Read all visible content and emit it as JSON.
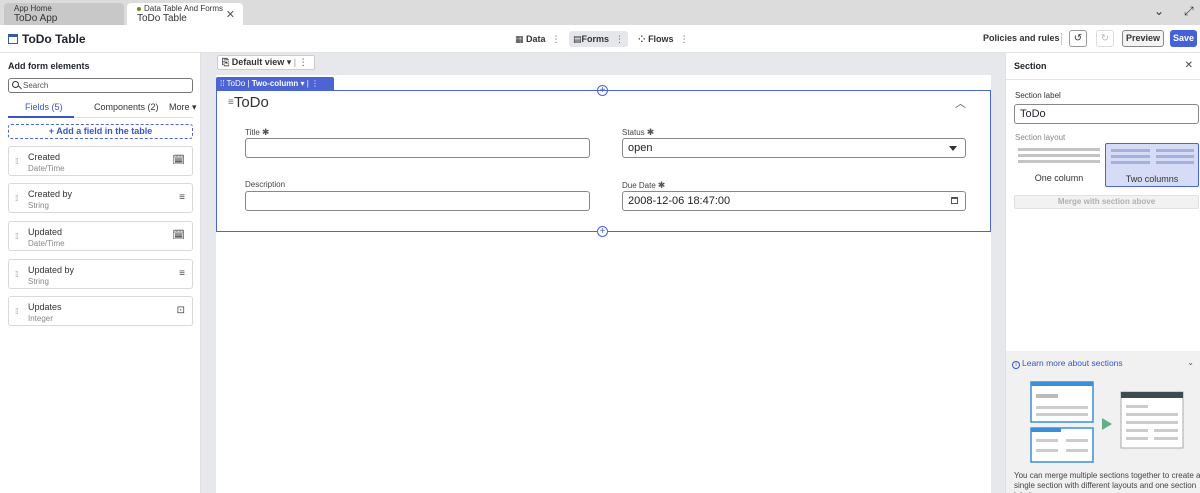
{
  "tabs": {
    "home": {
      "line1": "App Home",
      "line2": "ToDo App"
    },
    "active": {
      "line1": "Data Table And Forms",
      "line2": "ToDo Table"
    }
  },
  "header": {
    "title": "ToDo Table",
    "nav": [
      {
        "label": "Data",
        "icon": "table-icon"
      },
      {
        "label": "Forms",
        "icon": "form-icon"
      },
      {
        "label": "Flows",
        "icon": "flow-icon"
      }
    ],
    "policies_label": "Policies and rules",
    "preview_label": "Preview",
    "save_label": "Save"
  },
  "left_panel": {
    "title": "Add form elements",
    "search_placeholder": "Search",
    "tabs": [
      "Fields (5)",
      "Components (2)",
      "More"
    ],
    "add_field_label": "+ Add a field in the table",
    "fields": [
      {
        "name": "Created",
        "type": "Date/Time",
        "icon": "datetime-icon"
      },
      {
        "name": "Created by",
        "type": "String",
        "icon": "text-lines-icon"
      },
      {
        "name": "Updated",
        "type": "Date/Time",
        "icon": "datetime-icon"
      },
      {
        "name": "Updated by",
        "type": "String",
        "icon": "text-lines-icon"
      },
      {
        "name": "Updates",
        "type": "Integer",
        "icon": "integer-icon"
      }
    ]
  },
  "canvas": {
    "view_label": "Default view",
    "section_toolbar": {
      "name": "ToDo",
      "layout": "Two-column"
    },
    "section_title": "ToDo",
    "fields": [
      {
        "label": "Title",
        "required": true,
        "value": ""
      },
      {
        "label": "Status",
        "required": true,
        "value": "open"
      },
      {
        "label": "Description",
        "required": false,
        "value": ""
      },
      {
        "label": "Due Date",
        "required": true,
        "value": "2008-12-06 18:47:00"
      }
    ]
  },
  "right_panel": {
    "title": "Section",
    "section_label_caption": "Section label",
    "section_label_value": "ToDo",
    "layout_caption": "Section layout",
    "layouts": [
      "One column",
      "Two columns"
    ],
    "selected_layout": "Two columns",
    "merge_label": "Merge with section above",
    "learn_more": "Learn more about sections",
    "learn_text": "You can merge multiple sections together to create a single section with different layouts and one section label."
  },
  "colors": {
    "accent": "#4561d8",
    "section_border": "#4c64d4"
  }
}
